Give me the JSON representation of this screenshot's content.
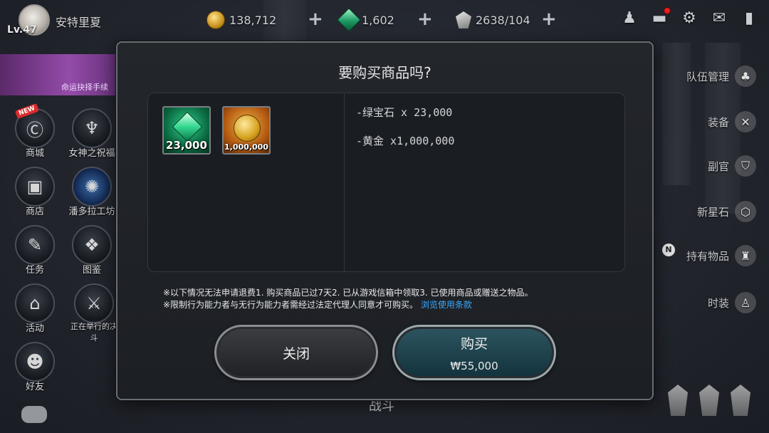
{
  "player": {
    "level": "Lv.47",
    "name": "安特里夏"
  },
  "resources": [
    {
      "icon": "gold-coin-icon",
      "value": "138,712"
    },
    {
      "icon": "emerald-icon",
      "value": "1,602"
    },
    {
      "icon": "stamina-icon",
      "value": "2638/104"
    }
  ],
  "left_menu": [
    {
      "label": "商城",
      "icon": "shop-c-icon",
      "badge": "NEW"
    },
    {
      "label": "女神之祝福",
      "icon": "goddess-icon"
    },
    {
      "label": "商店",
      "icon": "store-chest-icon"
    },
    {
      "label": "潘多拉工坊",
      "icon": "workshop-icon"
    },
    {
      "label": "任务",
      "icon": "quest-scroll-icon"
    },
    {
      "label": "图鉴",
      "icon": "codex-book-icon"
    },
    {
      "label": "活动",
      "icon": "gift-icon"
    },
    {
      "label": "正在举行的决斗",
      "icon": "duel-icon"
    },
    {
      "label": "好友",
      "icon": "friends-icon"
    }
  ],
  "banner": {
    "text": "命运抉择手续"
  },
  "right_menu": [
    {
      "label": "队伍管理",
      "icon": "team-icon"
    },
    {
      "label": "装备",
      "icon": "equipment-icon"
    },
    {
      "label": "副官",
      "icon": "adjutant-icon"
    },
    {
      "label": "新星石",
      "icon": "nova-stone-icon"
    },
    {
      "label": "持有物品",
      "icon": "inventory-icon",
      "badge": "N"
    },
    {
      "label": "时装",
      "icon": "costume-icon"
    }
  ],
  "bottom": {
    "battle_label": "战斗"
  },
  "modal": {
    "title": "要购买商品吗?",
    "items": [
      {
        "name": "emerald",
        "quantity": "23,000"
      },
      {
        "name": "gold",
        "quantity": "1,000,000"
      }
    ],
    "descriptions": [
      "-绿宝石 x 23,000",
      "-黄金 x1,000,000"
    ],
    "notice_line1": "※以下情况无法申请退费1. 购买商品已过7天2. 已从游戏信箱中领取3. 已使用商品或赠送之物品。",
    "notice_line2": "※限制行为能力者与无行为能力者需经过法定代理人同意才可购买。",
    "terms_link": "浏览使用条款",
    "close_label": "关闭",
    "buy_label": "购买",
    "price": "₩55,000"
  },
  "colors": {
    "link": "#3aa9ff",
    "notification": "#e32020",
    "buy_button": "#1e4550"
  }
}
